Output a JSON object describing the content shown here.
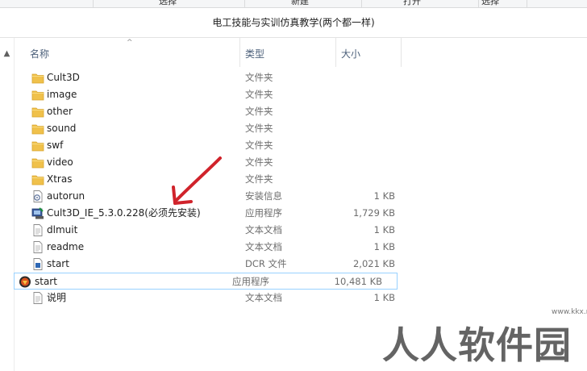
{
  "window": {
    "title": "电工技能与实训仿真教学(两个都一样)"
  },
  "ribbon": {
    "items": [
      "选择",
      "新建",
      "打开",
      "选择"
    ]
  },
  "columns": {
    "name": "名称",
    "type": "类型",
    "size": "大小"
  },
  "files": [
    {
      "name": "Cult3D",
      "type": "文件夹",
      "size": "",
      "icon": "folder-icon"
    },
    {
      "name": "image",
      "type": "文件夹",
      "size": "",
      "icon": "folder-icon"
    },
    {
      "name": "other",
      "type": "文件夹",
      "size": "",
      "icon": "folder-icon"
    },
    {
      "name": "sound",
      "type": "文件夹",
      "size": "",
      "icon": "folder-icon"
    },
    {
      "name": "swf",
      "type": "文件夹",
      "size": "",
      "icon": "folder-icon"
    },
    {
      "name": "video",
      "type": "文件夹",
      "size": "",
      "icon": "folder-icon"
    },
    {
      "name": "Xtras",
      "type": "文件夹",
      "size": "",
      "icon": "folder-icon"
    },
    {
      "name": "autorun",
      "type": "安装信息",
      "size": "1 KB",
      "icon": "setup-info-icon"
    },
    {
      "name": "Cult3D_IE_5.3.0.228(必须先安装)",
      "type": "应用程序",
      "size": "1,729 KB",
      "icon": "installer-icon"
    },
    {
      "name": "dlmuit",
      "type": "文本文档",
      "size": "1 KB",
      "icon": "text-file-icon"
    },
    {
      "name": "readme",
      "type": "文本文档",
      "size": "1 KB",
      "icon": "text-file-icon"
    },
    {
      "name": "start",
      "type": "DCR 文件",
      "size": "2,021 KB",
      "icon": "dcr-file-icon"
    },
    {
      "name": "start",
      "type": "应用程序",
      "size": "10,481 KB",
      "icon": "app-icon",
      "highlighted": true
    },
    {
      "name": "说明",
      "type": "文本文档",
      "size": "1 KB",
      "icon": "text-file-icon"
    }
  ],
  "watermark": {
    "text": "人人软件园",
    "url": "www.kkx.net"
  }
}
